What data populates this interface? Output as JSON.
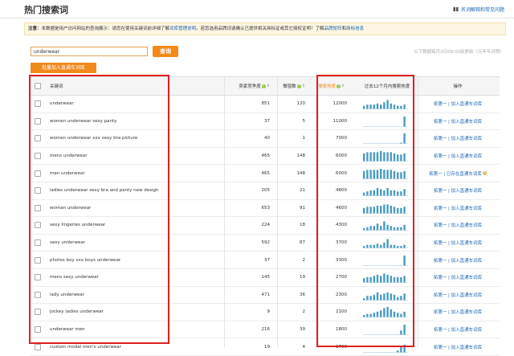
{
  "header": {
    "title": "热门搜索词",
    "help_link": "名词解释和常见问题"
  },
  "notice": {
    "label": "注意：",
    "text": "本数据是用户访问网站的查询展示：请您在使用关键词前详细了解",
    "link1": "词库管理说明",
    "text2": "。若您选用品牌词请确认已提供相关商标证或其它授权证明！了解",
    "link2": "品牌矩阵",
    "text3": "和",
    "link3": "商标信息"
  },
  "search": {
    "value": "underwear",
    "button": "查询",
    "update_note": "以下数据每月3日09:00前更新（元年年对照）"
  },
  "batch_button": "批量加入直通车词库",
  "table": {
    "headers": {
      "keyword": "关键词",
      "competition": "卖家竞争度",
      "bids": "餐窗数",
      "heat": "搜索热度",
      "trend": "过去12个月内搜索热度",
      "ops": "操作"
    },
    "rows": [
      {
        "keyword": "underwear",
        "competition": "851",
        "bids": "120",
        "heat": "12000",
        "trend": [
          3,
          4,
          4,
          4,
          5,
          4,
          6,
          8,
          5,
          4,
          3,
          3,
          4
        ],
        "op": "拓第一 | 加入直通车词库"
      },
      {
        "keyword": "women underwear sexy panty",
        "competition": "37",
        "bids": "5",
        "heat": "11000",
        "trend": [
          0,
          0,
          0,
          0,
          0,
          0,
          0,
          0,
          0,
          0,
          0,
          0,
          9
        ],
        "op": "拓第一 | 加入直通车词库"
      },
      {
        "keyword": "women underwear xxx sexy bra picture",
        "competition": "40",
        "bids": "1",
        "heat": "7000",
        "trend": [
          0,
          0,
          0,
          0,
          0,
          0,
          0,
          0,
          0,
          0,
          0,
          1,
          9
        ],
        "op": "拓第一 | 加入直通车词库"
      },
      {
        "keyword": "mens underwear",
        "competition": "465",
        "bids": "148",
        "heat": "6000",
        "trend": [
          7,
          8,
          8,
          8,
          8,
          9,
          8,
          8,
          8,
          7,
          6,
          6,
          7
        ],
        "op": "拓第一 | 加入直通车词库"
      },
      {
        "keyword": "man underwear",
        "competition": "465",
        "bids": "148",
        "heat": "6000",
        "trend": [
          7,
          8,
          8,
          8,
          8,
          9,
          8,
          8,
          8,
          7,
          6,
          6,
          7
        ],
        "op": "拓第一 | 已存在直通车词库",
        "op_locked": true
      },
      {
        "keyword": "ladies underwear sexy bra and panty new design",
        "competition": "205",
        "bids": "21",
        "heat": "4800",
        "trend": [
          3,
          4,
          5,
          5,
          7,
          6,
          5,
          7,
          5,
          5,
          4,
          4,
          6
        ],
        "op": "拓第一 | 加入直通车词库"
      },
      {
        "keyword": "woman underwear",
        "competition": "653",
        "bids": "91",
        "heat": "4600",
        "trend": [
          5,
          6,
          6,
          6,
          7,
          7,
          8,
          8,
          7,
          6,
          5,
          5,
          6
        ],
        "op": "拓第一 | 加入直通车词库"
      },
      {
        "keyword": "sexy lingeries underwear",
        "competition": "224",
        "bids": "18",
        "heat": "4300",
        "trend": [
          2,
          3,
          4,
          4,
          6,
          4,
          8,
          5,
          4,
          3,
          3,
          3,
          5
        ],
        "op": "拓第一 | 加入直通车词库"
      },
      {
        "keyword": "sexy underwear",
        "competition": "592",
        "bids": "87",
        "heat": "3700",
        "trend": [
          2,
          3,
          3,
          3,
          4,
          3,
          5,
          8,
          3,
          3,
          2,
          2,
          3
        ],
        "op": "拓第一 | 加入直通车词库"
      },
      {
        "keyword": "photos boy xxx boys underwear",
        "competition": "37",
        "bids": "2",
        "heat": "3300",
        "trend": [
          0,
          0,
          0,
          0,
          0,
          0,
          0,
          0,
          0,
          0,
          0,
          0,
          9
        ],
        "op": "拓第一 | 加入直通车词库"
      },
      {
        "keyword": "mens sexy underwear",
        "competition": "145",
        "bids": "19",
        "heat": "2700",
        "trend": [
          4,
          5,
          5,
          6,
          7,
          6,
          8,
          7,
          6,
          5,
          5,
          5,
          6
        ],
        "op": "拓第一 | 加入直通车词库"
      },
      {
        "keyword": "lady underwear",
        "competition": "471",
        "bids": "36",
        "heat": "2300",
        "trend": [
          2,
          4,
          4,
          5,
          7,
          5,
          6,
          7,
          6,
          5,
          3,
          4,
          6
        ],
        "op": "拓第一 | 加入直通车词库"
      },
      {
        "keyword": "jockey ladies underwear",
        "competition": "9",
        "bids": "2",
        "heat": "2100",
        "trend": [
          2,
          3,
          3,
          4,
          5,
          6,
          8,
          9,
          7,
          5,
          4,
          3,
          5
        ],
        "op": "拓第一 | 加入直通车词库"
      },
      {
        "keyword": "underwear men",
        "competition": "216",
        "bids": "39",
        "heat": "1800",
        "trend": [
          0,
          0,
          0,
          0,
          0,
          0,
          0,
          0,
          0,
          0,
          0,
          4,
          9
        ],
        "op": "拓第一 | 加入直通车词库"
      },
      {
        "keyword": "custom modal men's underwear",
        "competition": "19",
        "bids": "4",
        "heat": "1700",
        "trend": [
          0,
          0,
          0,
          0,
          0,
          0,
          0,
          0,
          0,
          0,
          2,
          6,
          7
        ],
        "op": "拓第一 | 加入直通车词库"
      }
    ]
  },
  "colors": {
    "accent": "#f18a1a",
    "link": "#1a66b3",
    "spark": "#4a9bbf",
    "highlight": "#e02020"
  }
}
